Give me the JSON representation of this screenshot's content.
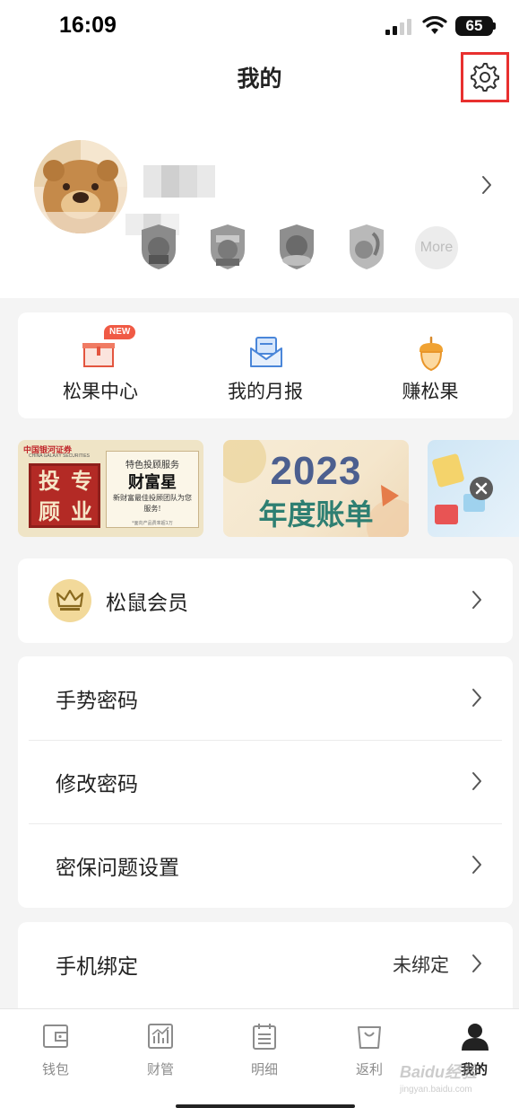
{
  "status_bar": {
    "time": "16:09",
    "battery": "65"
  },
  "header": {
    "title": "我的"
  },
  "profile": {
    "badges": [
      "squirrel-badge-1",
      "squirrel-badge-2",
      "squirrel-badge-3",
      "squirrel-badge-4"
    ],
    "more_label": "More"
  },
  "quick_actions": [
    {
      "label": "松果中心",
      "icon": "gift-box-icon",
      "tag": "NEW"
    },
    {
      "label": "我的月报",
      "icon": "envelope-icon"
    },
    {
      "label": "赚松果",
      "icon": "acorn-icon"
    }
  ],
  "banners": {
    "galaxy": {
      "logo": "中国银河证券",
      "logo_en": "CHINA GALAXY SECURITIES",
      "seal": [
        "投",
        "专",
        "顾",
        "业"
      ],
      "line1": "特色投顾服务",
      "line2": "财富星",
      "line3": "新财富最佳投顾团队为您服务!",
      "note": "*面向产品费率超1万"
    },
    "annual": {
      "year": "2023",
      "title": "年度账单"
    }
  },
  "vip": {
    "label": "松鼠会员"
  },
  "security": [
    {
      "label": "手势密码"
    },
    {
      "label": "修改密码"
    },
    {
      "label": "密保问题设置"
    }
  ],
  "phone": {
    "label": "手机绑定",
    "value": "未绑定"
  },
  "tabs": [
    {
      "label": "钱包",
      "icon": "wallet-icon"
    },
    {
      "label": "财管",
      "icon": "chart-icon"
    },
    {
      "label": "明细",
      "icon": "list-icon"
    },
    {
      "label": "返利",
      "icon": "bag-icon"
    },
    {
      "label": "我的",
      "icon": "user-icon",
      "active": true
    }
  ],
  "watermark": {
    "text": "Baidu经验",
    "sub": "jingyan.baidu.com"
  },
  "colors": {
    "accent_red": "#e8302f",
    "gold": "#e9a93a",
    "tab_active": "#222222",
    "tab_inactive": "#8c8c8c"
  }
}
